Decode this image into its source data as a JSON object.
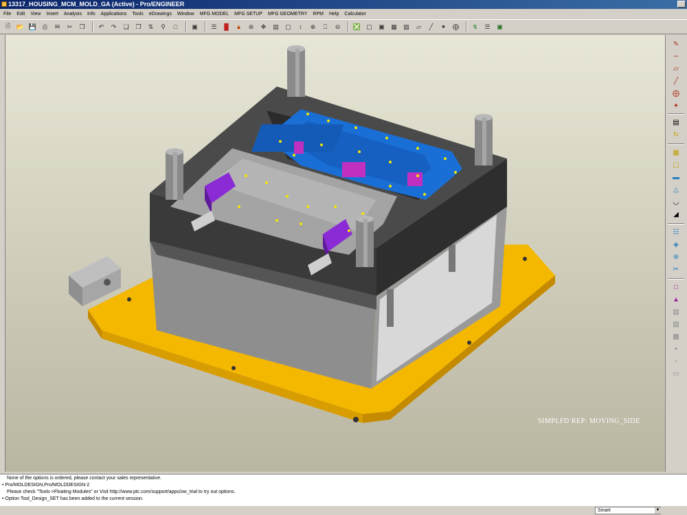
{
  "window": {
    "title": "13317_HOUSING_MCM_MOLD_GA (Active) - Pro/ENGINEER"
  },
  "menu": [
    "File",
    "Edit",
    "View",
    "Insert",
    "Analysis",
    "Info",
    "Applications",
    "Tools",
    "eDrawings",
    "Window",
    "MFG MODEL",
    "MFG SETUP",
    "MFG GEOMETRY",
    "RPM",
    "Help",
    "Calculator"
  ],
  "viewport": {
    "simplified_rep": "SIMPLFD REP: MOVING_SIDE"
  },
  "messages": [
    "None of the options  is ordered, please contact your sales representative.",
    "• Pro/MOLDESIGN,Pro/MOLDDESIGN-2",
    "Please check \"Tools->Floating Modules\" or Visit http://www.ptc.com/support/apps/ow_trial to try out options.",
    "• Option Tool_Design_SET has been added to the current session."
  ],
  "filter": {
    "value": "Smart"
  },
  "colors": {
    "base_plate": "#f5b800",
    "cavity": "#1a6fd6",
    "slider": "#8a2bd6",
    "mold_dark": "#3a3a3a",
    "mold_grey": "#8e8e8e"
  }
}
